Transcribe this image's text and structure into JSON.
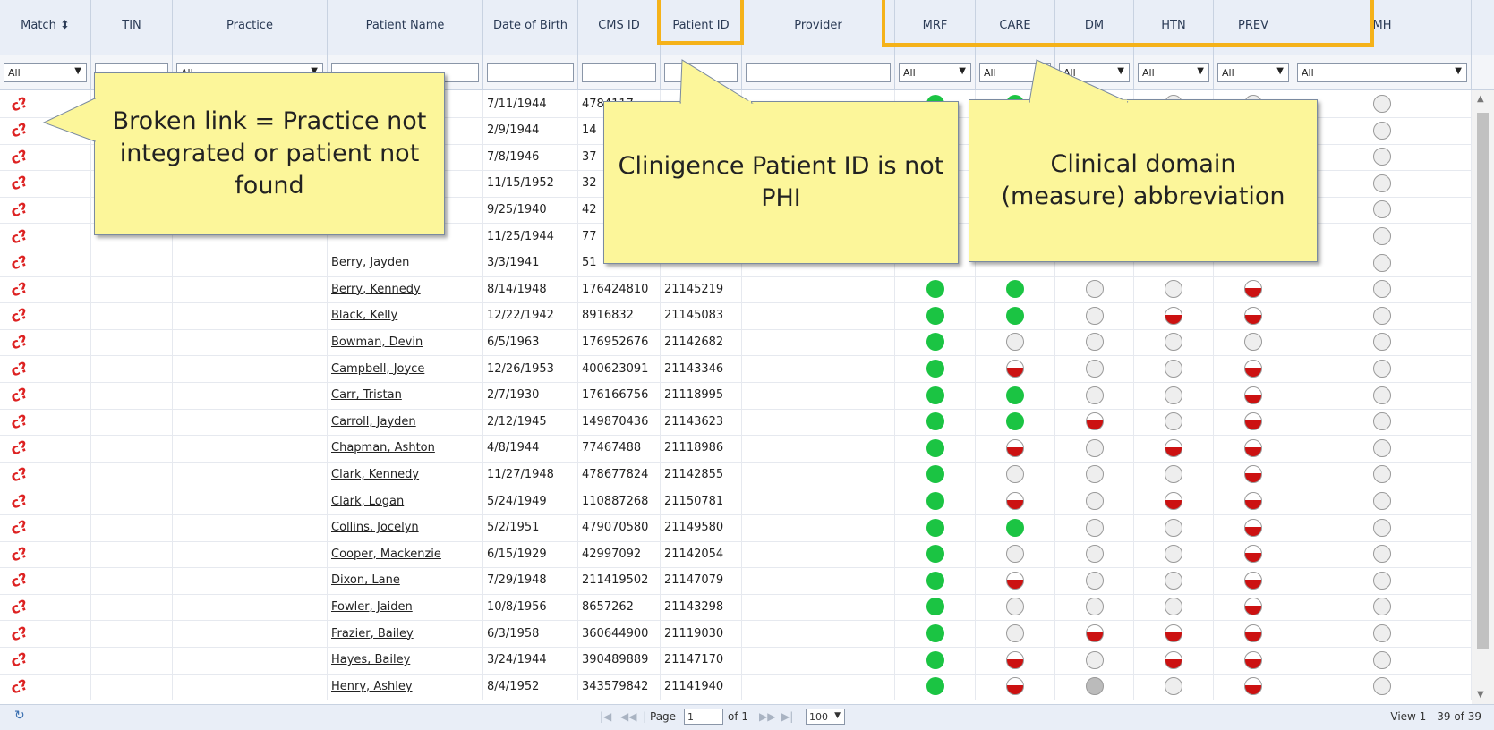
{
  "columns": [
    {
      "key": "match",
      "label": "Match ⬍"
    },
    {
      "key": "tin",
      "label": "TIN"
    },
    {
      "key": "practice",
      "label": "Practice"
    },
    {
      "key": "patient_name",
      "label": "Patient Name"
    },
    {
      "key": "dob",
      "label": "Date of Birth"
    },
    {
      "key": "cms_id",
      "label": "CMS ID"
    },
    {
      "key": "patient_id",
      "label": "Patient ID"
    },
    {
      "key": "provider",
      "label": "Provider"
    },
    {
      "key": "mrf",
      "label": "MRF"
    },
    {
      "key": "care",
      "label": "CARE"
    },
    {
      "key": "dm",
      "label": "DM"
    },
    {
      "key": "htn",
      "label": "HTN"
    },
    {
      "key": "prev",
      "label": "PREV"
    },
    {
      "key": "mh",
      "label": "MH"
    }
  ],
  "filters": {
    "all": "All",
    "practice_all": "All"
  },
  "rows": [
    {
      "name": "",
      "dob": "7/11/1944",
      "cms": "4784117",
      "pid": "",
      "s": [
        "g",
        "g",
        "n",
        "n",
        "n",
        "n"
      ]
    },
    {
      "name": "",
      "dob": "2/9/1944",
      "cms": "14",
      "pid": "",
      "s": [
        "",
        "",
        "",
        "",
        "",
        "n"
      ]
    },
    {
      "name": "",
      "dob": "7/8/1946",
      "cms": "37",
      "pid": "",
      "s": [
        "",
        "",
        "",
        "",
        "",
        "n"
      ]
    },
    {
      "name": "",
      "dob": "11/15/1952",
      "cms": "32",
      "pid": "",
      "s": [
        "",
        "",
        "",
        "",
        "",
        "n"
      ]
    },
    {
      "name": "",
      "dob": "9/25/1940",
      "cms": "42",
      "pid": "",
      "s": [
        "",
        "",
        "",
        "",
        "",
        "n"
      ]
    },
    {
      "name": "",
      "dob": "11/25/1944",
      "cms": "77",
      "pid": "",
      "s": [
        "",
        "",
        "",
        "",
        "",
        "n"
      ]
    },
    {
      "name": "Berry, Jayden",
      "dob": "3/3/1941",
      "cms": "51",
      "pid": "",
      "s": [
        "",
        "",
        "",
        "",
        "",
        "n"
      ]
    },
    {
      "name": "Berry, Kennedy",
      "dob": "8/14/1948",
      "cms": "176424810",
      "pid": "21145219",
      "s": [
        "g",
        "g",
        "n",
        "n",
        "h",
        "n"
      ]
    },
    {
      "name": "Black, Kelly",
      "dob": "12/22/1942",
      "cms": "8916832",
      "pid": "21145083",
      "s": [
        "g",
        "g",
        "n",
        "h",
        "h",
        "n"
      ]
    },
    {
      "name": "Bowman, Devin",
      "dob": "6/5/1963",
      "cms": "176952676",
      "pid": "21142682",
      "s": [
        "g",
        "n",
        "n",
        "n",
        "n",
        "n"
      ]
    },
    {
      "name": "Campbell, Joyce",
      "dob": "12/26/1953",
      "cms": "400623091",
      "pid": "21143346",
      "s": [
        "g",
        "h",
        "n",
        "n",
        "h",
        "n"
      ]
    },
    {
      "name": "Carr, Tristan",
      "dob": "2/7/1930",
      "cms": "176166756",
      "pid": "21118995",
      "s": [
        "g",
        "g",
        "n",
        "n",
        "h",
        "n"
      ]
    },
    {
      "name": "Carroll, Jayden",
      "dob": "2/12/1945",
      "cms": "149870436",
      "pid": "21143623",
      "s": [
        "g",
        "g",
        "h",
        "n",
        "h",
        "n"
      ]
    },
    {
      "name": "Chapman, Ashton",
      "dob": "4/8/1944",
      "cms": "77467488",
      "pid": "21118986",
      "s": [
        "g",
        "h",
        "n",
        "h",
        "h",
        "n"
      ]
    },
    {
      "name": "Clark, Kennedy",
      "dob": "11/27/1948",
      "cms": "478677824",
      "pid": "21142855",
      "s": [
        "g",
        "n",
        "n",
        "n",
        "h",
        "n"
      ]
    },
    {
      "name": "Clark, Logan",
      "dob": "5/24/1949",
      "cms": "110887268",
      "pid": "21150781",
      "s": [
        "g",
        "h",
        "n",
        "h",
        "h",
        "n"
      ]
    },
    {
      "name": "Collins, Jocelyn",
      "dob": "5/2/1951",
      "cms": "479070580",
      "pid": "21149580",
      "s": [
        "g",
        "g",
        "n",
        "n",
        "h",
        "n"
      ]
    },
    {
      "name": "Cooper, Mackenzie",
      "dob": "6/15/1929",
      "cms": "42997092",
      "pid": "21142054",
      "s": [
        "g",
        "n",
        "n",
        "n",
        "h",
        "n"
      ]
    },
    {
      "name": "Dixon, Lane",
      "dob": "7/29/1948",
      "cms": "211419502",
      "pid": "21147079",
      "s": [
        "g",
        "h",
        "n",
        "n",
        "h",
        "n"
      ]
    },
    {
      "name": "Fowler, Jaiden",
      "dob": "10/8/1956",
      "cms": "8657262",
      "pid": "21143298",
      "s": [
        "g",
        "n",
        "n",
        "n",
        "h",
        "n"
      ]
    },
    {
      "name": "Frazier, Bailey",
      "dob": "6/3/1958",
      "cms": "360644900",
      "pid": "21119030",
      "s": [
        "g",
        "n",
        "h",
        "h",
        "h",
        "n"
      ]
    },
    {
      "name": "Hayes, Bailey",
      "dob": "3/24/1944",
      "cms": "390489889",
      "pid": "21147170",
      "s": [
        "g",
        "h",
        "n",
        "h",
        "h",
        "n"
      ]
    },
    {
      "name": "Henry, Ashley",
      "dob": "8/4/1952",
      "cms": "343579842",
      "pid": "21141940",
      "s": [
        "g",
        "h",
        "x",
        "n",
        "h",
        "n"
      ]
    }
  ],
  "pager": {
    "page_label": "Page",
    "page_value": "1",
    "of_label": "of 1",
    "size": "100",
    "view": "View 1 - 39 of 39"
  },
  "callouts": {
    "broken_link": "Broken link = Practice not integrated or patient not found",
    "patient_id": "Clinigence Patient ID is not PHI",
    "domain": "Clinical domain (measure) abbreviation"
  },
  "colors": {
    "accent": "#f5b21a",
    "callout": "#fcf69a",
    "met": "#1bc443",
    "not_met": "#cc1111"
  }
}
